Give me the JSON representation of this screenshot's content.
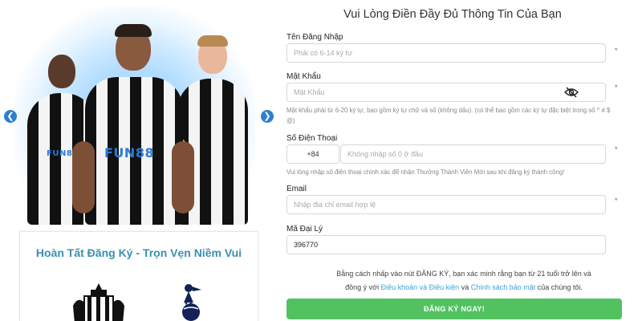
{
  "banner": {
    "prev_icon": "chevron-left-icon",
    "next_icon": "chevron-right-icon",
    "arrow_color": "#2f7fd0",
    "sponsor_text": "FUN88",
    "promo_title": "Hoàn Tất Đăng Ký - Trọn Vẹn Niềm Vui",
    "promo_title_color": "#3a8fb0",
    "crests": [
      "newcastle-crest-icon",
      "tottenham-crest-icon"
    ]
  },
  "form": {
    "title": "Vui Lòng Điền Đầy Đủ Thông Tin Của Bạn",
    "username": {
      "label": "Tên Đăng Nhập",
      "placeholder": "Phải có 6-14 ký tự",
      "value": "",
      "required_mark": "*"
    },
    "password": {
      "label": "Mật Khẩu",
      "placeholder": "Mật Khẩu",
      "value": "",
      "required_mark": "*",
      "toggle_icon": "eye-slash-icon",
      "hint": "Mật khẩu phải từ 6-20 ký tự, bao gồm ký tự chữ và số (không dấu). (có thể bao gồm các ký tự đặc biệt trong số ^ # $ @)"
    },
    "phone": {
      "label": "Số Điện Thoại",
      "prefix": "+84",
      "placeholder": "Không nhập số 0 ở đầu",
      "value": "",
      "required_mark": "*",
      "hint": "Vui lòng nhập số điện thoại chính xác để nhận Thưởng Thành Viên Mới sau khi đăng ký thành công!"
    },
    "email": {
      "label": "Email",
      "placeholder": "Nhập địa chỉ email hợp lệ",
      "value": "",
      "required_mark": "*"
    },
    "agent_code": {
      "label": "Mã Đại Lý",
      "value": "396770"
    },
    "terms": {
      "line1": "Bằng cách nhấp vào nút ĐĂNG KÝ, bạn xác minh rằng bạn từ 21 tuổi trở lên và",
      "line2_prefix": "đồng ý với",
      "terms_link": "Điều khoản và Điều kiện",
      "and": "và",
      "privacy_link": "Chính sách bảo mật",
      "line2_suffix": "của chúng tôi.",
      "link_color": "#3ba3d6"
    },
    "submit_label": "ĐĂNG KÝ NGAY!",
    "submit_color": "#52c260"
  }
}
